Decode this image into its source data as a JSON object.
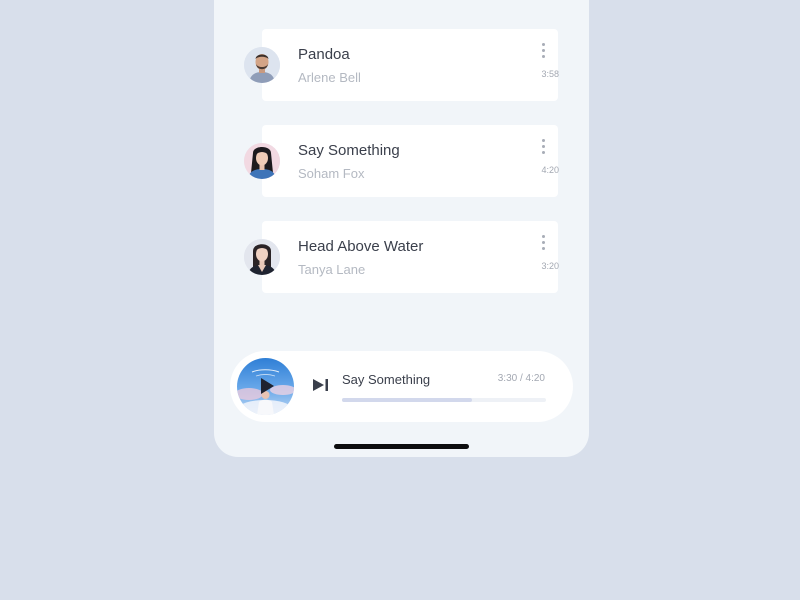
{
  "tracks": [
    {
      "title": "Pandoa",
      "artist": "Arlene Bell",
      "duration": "3:58",
      "avatar": "man-beard-avatar"
    },
    {
      "title": "Say Something",
      "artist": "Soham Fox",
      "duration": "4:20",
      "avatar": "woman-black-hair-avatar"
    },
    {
      "title": "Head Above Water",
      "artist": "Tanya Lane",
      "duration": "3:20",
      "avatar": "woman-dark-hair-avatar"
    }
  ],
  "now_playing": {
    "title": "Say Something",
    "time": "3:30 / 4:20",
    "progress": 0.637,
    "album_art": "album-cover-sky",
    "play_icon": "play-icon",
    "next_icon": "skip-next-icon"
  },
  "colors": {
    "page_background": "#d8dfeb",
    "phone_background": "#f1f5f9",
    "card_background": "#ffffff",
    "title_text": "#3a3f4b",
    "secondary_text": "#b4b9c2",
    "progress_fill": "#d2d8ec",
    "progress_track": "#eef1f6"
  }
}
